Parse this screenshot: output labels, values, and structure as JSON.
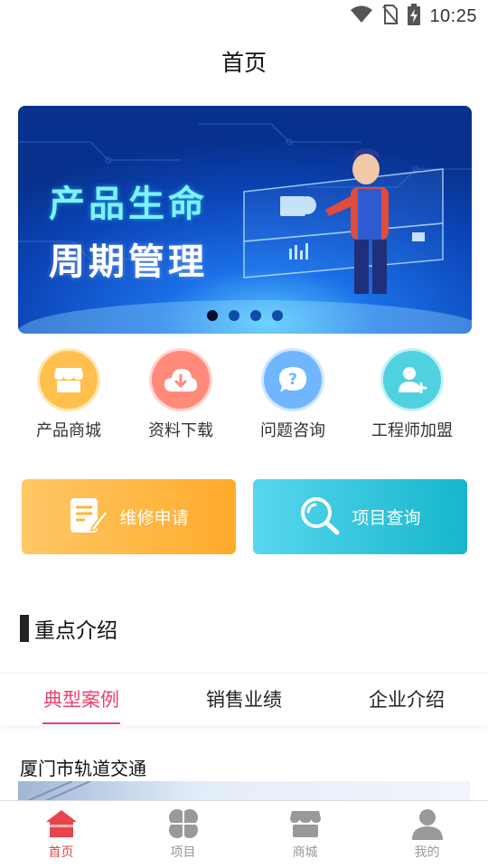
{
  "status_bar": {
    "time": "10:25",
    "icons": [
      "wifi-icon",
      "no-sim-icon",
      "battery-charging-icon"
    ]
  },
  "header": {
    "title": "首页"
  },
  "banner": {
    "line1": "产品生命",
    "line2": "周期管理",
    "dots": 4,
    "active_dot": 0
  },
  "quick_entries": [
    {
      "label": "产品商城",
      "icon": "shop-icon",
      "color": "#ffc04d"
    },
    {
      "label": "资料下载",
      "icon": "cloud-download-icon",
      "color": "#ff8a7a"
    },
    {
      "label": "问题咨询",
      "icon": "question-chat-icon",
      "color": "#6fb6ff"
    },
    {
      "label": "工程师加盟",
      "icon": "add-user-icon",
      "color": "#4fd1e0"
    }
  ],
  "cards": {
    "repair": {
      "label": "维修申请",
      "icon": "edit-document-icon"
    },
    "query": {
      "label": "项目查询",
      "icon": "search-icon"
    }
  },
  "section": {
    "title": "重点介绍"
  },
  "tabs": [
    {
      "label": "典型案例",
      "active": true
    },
    {
      "label": "销售业绩",
      "active": false
    },
    {
      "label": "企业介绍",
      "active": false
    }
  ],
  "case": {
    "title": "厦门市轨道交通"
  },
  "bottom_nav": [
    {
      "label": "首页",
      "icon": "home-icon",
      "active": true
    },
    {
      "label": "项目",
      "icon": "clover-icon",
      "active": false
    },
    {
      "label": "商城",
      "icon": "store-icon",
      "active": false
    },
    {
      "label": "我的",
      "icon": "profile-icon",
      "active": false
    }
  ],
  "colors": {
    "accent": "#e8446b",
    "nav_active": "#e8444b",
    "banner_bg": "#0a3fa8"
  }
}
